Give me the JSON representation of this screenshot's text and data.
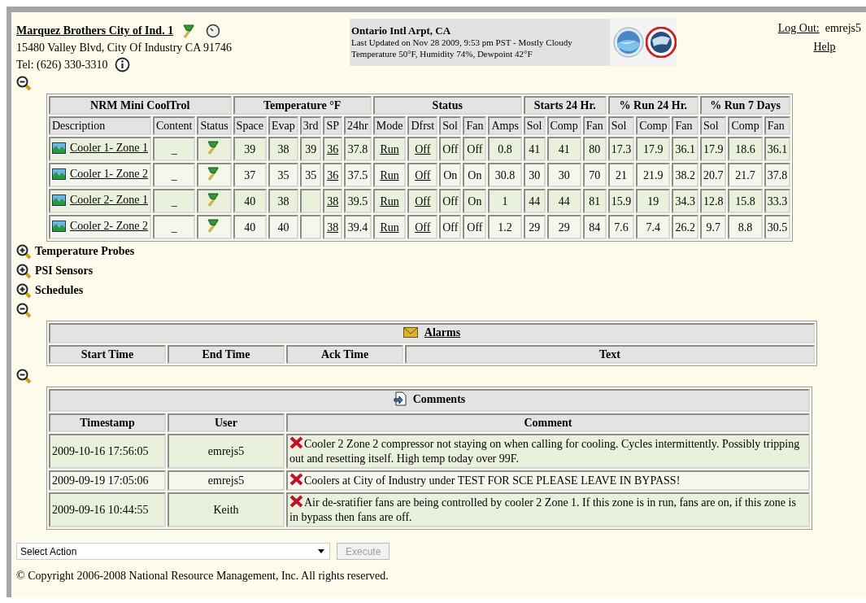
{
  "site": {
    "name": "Marquez Brothers City of Ind. 1",
    "address": "15480 Valley Blvd, City Of Industry CA 91746",
    "phone": "Tel: (626) 330-3310"
  },
  "weather": {
    "station": "Ontario Intl Arpt, CA",
    "updated": "Last Updated on Nov 28 2009, 9:53 pm PST - Mostly Cloudy",
    "conditions": "Temperature 50°F, Humidity 74%, Dewpoint 42°F"
  },
  "account": {
    "logout": "Log Out:",
    "user": "emrejs5",
    "help": "Help"
  },
  "units": {
    "expanded": true,
    "groups": [
      {
        "label": "NRM Mini CoolTrol",
        "columns": [
          {
            "label": "Description",
            "kind": "trend-link"
          },
          {
            "label": "Content",
            "kind": "text"
          },
          {
            "label": "Status",
            "kind": "flag"
          }
        ]
      },
      {
        "label": "Temperature °F",
        "columns": [
          {
            "label": "Space",
            "kind": "text"
          },
          {
            "label": "Evap",
            "kind": "text"
          },
          {
            "label": "3rd",
            "kind": "text"
          },
          {
            "label": "SP",
            "kind": "link"
          },
          {
            "label": "24hr",
            "kind": "text"
          }
        ]
      },
      {
        "label": "Status",
        "columns": [
          {
            "label": "Mode",
            "kind": "link"
          },
          {
            "label": "Dfrst",
            "kind": "link"
          },
          {
            "label": "Sol",
            "kind": "text"
          },
          {
            "label": "Fan",
            "kind": "text"
          },
          {
            "label": "Amps",
            "kind": "text"
          }
        ]
      },
      {
        "label": "Starts 24 Hr.",
        "columns": [
          {
            "label": "Sol",
            "kind": "text"
          },
          {
            "label": "Comp",
            "kind": "text"
          },
          {
            "label": "Fan",
            "kind": "text"
          }
        ]
      },
      {
        "label": "% Run 24 Hr.",
        "columns": [
          {
            "label": "Sol",
            "kind": "text"
          },
          {
            "label": "Comp",
            "kind": "text"
          },
          {
            "label": "Fan",
            "kind": "text"
          }
        ]
      },
      {
        "label": "% Run 7 Days",
        "columns": [
          {
            "label": "Sol",
            "kind": "text"
          },
          {
            "label": "Comp",
            "kind": "text"
          },
          {
            "label": "Fan",
            "kind": "text"
          }
        ]
      }
    ],
    "rows": [
      {
        "cells": [
          "Cooler 1- Zone 1",
          "_",
          null,
          "39",
          "38",
          "39",
          "36",
          "37.8",
          "Run",
          "Off",
          "Off",
          "Off",
          "0.8",
          "41",
          "41",
          "80",
          "17.3",
          "17.9",
          "36.1",
          "17.9",
          "18.6",
          "36.1"
        ]
      },
      {
        "cells": [
          "Cooler 1- Zone 2",
          "_",
          null,
          "37",
          "35",
          "35",
          "36",
          "37.5",
          "Run",
          "Off",
          "On",
          "On",
          "30.8",
          "30",
          "30",
          "70",
          "21",
          "21.9",
          "38.2",
          "20.7",
          "21.7",
          "37.8"
        ]
      },
      {
        "cells": [
          "Cooler 2- Zone 1",
          "_",
          null,
          "40",
          "38",
          null,
          "38",
          "39.5",
          "Run",
          "Off",
          "Off",
          "On",
          "1",
          "44",
          "44",
          "81",
          "15.9",
          "19",
          "34.3",
          "12.8",
          "15.8",
          "33.3"
        ]
      },
      {
        "cells": [
          "Cooler 2- Zone 2",
          "_",
          null,
          "40",
          "40",
          null,
          "38",
          "39.4",
          "Run",
          "Off",
          "Off",
          "Off",
          "1.2",
          "29",
          "29",
          "84",
          "7.6",
          "7.4",
          "26.2",
          "9.7",
          "8.8",
          "30.5"
        ]
      }
    ]
  },
  "sections": [
    {
      "label": "Temperature Probes",
      "expanded": false
    },
    {
      "label": "PSI Sensors",
      "expanded": false
    },
    {
      "label": "Schedules",
      "expanded": false
    }
  ],
  "alarms": {
    "expanded": true,
    "title": "Alarms",
    "columns": [
      "Start Time",
      "End Time",
      "Ack Time",
      "Text"
    ]
  },
  "comments": {
    "expanded": true,
    "title": "Comments",
    "columns": [
      "Timestamp",
      "User",
      "Comment"
    ],
    "rows": [
      {
        "timestamp": "2009-10-16 17:56:05",
        "user": "emrejs5",
        "comment": "Cooler 2 Zone 2 compressor not staying on when calling for cooling. Cycles intermittently. Possibly tripping out and resetting itself. High temp today over 99F."
      },
      {
        "timestamp": "2009-09-19 17:05:06",
        "user": "emrejs5",
        "comment": "Coolers at City of Industry under TEST FOR SCE PLEASE LEAVE IN BYPASS!"
      },
      {
        "timestamp": "2009-09-16 10:44:55",
        "user": "Keith",
        "comment": "Air de-sratifier fans are being controlled by cooler 2 Zone 1. If this zone is in run, fans are on, if this zone is in bypass then fans are off."
      }
    ]
  },
  "action": {
    "value": "Select Action",
    "button": "Execute",
    "disabled": true
  },
  "copyright": "© Copyright 2006-2008 National Resource Management, Inc. All rights reserved."
}
